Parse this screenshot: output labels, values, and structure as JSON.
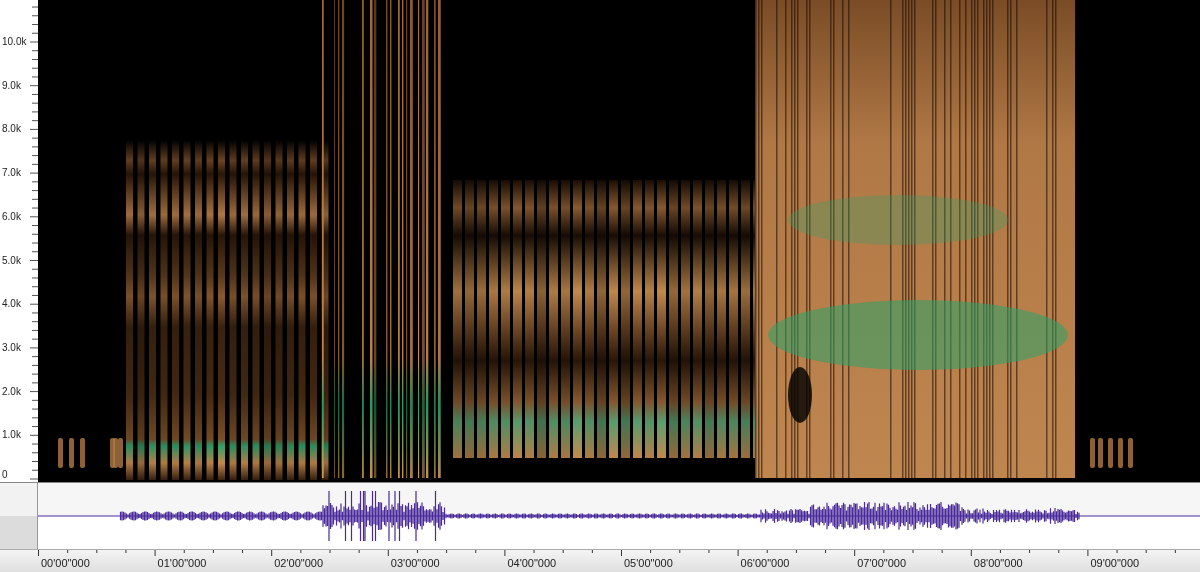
{
  "frequency_axis": {
    "labels": [
      "10.0k",
      "9.0k",
      "8.0k",
      "7.0k",
      "6.0k",
      "5.0k",
      "4.0k",
      "3.0k",
      "2.0k",
      "1.0k",
      "0"
    ]
  },
  "time_axis": {
    "labels": [
      "00'00\"000",
      "01'00\"000",
      "02'00\"000",
      "03'00\"000",
      "04'00\"000",
      "05'00\"000",
      "06'00\"000",
      "07'00\"000",
      "08'00\"000",
      "09'00\"000"
    ]
  }
}
